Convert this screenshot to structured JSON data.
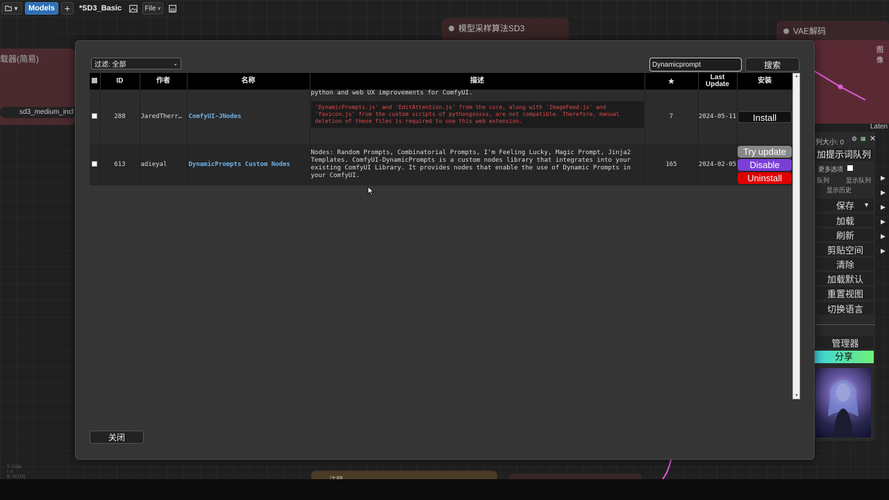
{
  "toolbar": {
    "models_label": "Models",
    "add_label": "+",
    "workflow_title": "*SD3_Basic",
    "file_label": "File"
  },
  "background_nodes": {
    "sampler_title": "模型采样算法SD3",
    "vae_title": "VAE解码",
    "left_title": "载器(简易)",
    "left_value": "sd3_medium_incl",
    "right_top_label": "图像",
    "right_latent_label": "Laten",
    "bottom_title": "注释",
    "bottom_stats": [
      "T: 0.00s",
      "I: 0",
      "N: 15 [15]"
    ]
  },
  "side_panel": {
    "queue_size": "列大小: 0",
    "enqueue": "加提示词队列",
    "more_options": "更多选项",
    "small_left": "队列",
    "small_right": "显示队列",
    "small_history": "显示历史",
    "items": [
      "保存",
      "加载",
      "刷新",
      "剪贴空间",
      "清除",
      "加载默认",
      "重置视图",
      "切换语言"
    ],
    "manager": "管理器",
    "share": "分享"
  },
  "modal": {
    "filter_label": "过滤: 全部",
    "search_value": "Dynamicprompt",
    "search_button": "搜索",
    "close_button": "关闭",
    "columns": {
      "id": "ID",
      "author": "作者",
      "name": "名称",
      "description": "描述",
      "stars": "★",
      "last_update": "Last Update",
      "install": "安装"
    },
    "rows": [
      {
        "id": "288",
        "author": "JaredTherr…",
        "name": "ComfyUI-JNodes",
        "description": "python and web UX improvements for ComfyUI.",
        "warning": "'DynamicPrompts.js' and 'EditAttention.js' from the core, along with 'ImageFeed.js' and 'favicon.js' from the custom scripts of pythongossss, are not compatible. Therefore, manual deletion of these files is required to use this web extension.",
        "stars": "7",
        "last_update": "2024-05-11",
        "install_label": "Install"
      },
      {
        "id": "613",
        "author": "adieyal",
        "name": "DynamicPrompts Custom Nodes",
        "description": "Nodes: Random Prompts, Combinatorial Prompts, I'm Feeling Lucky, Magic Prompt, Jinja2 Templates. ComfyUI-DynamicPrompts is a custom nodes library that integrates into your existing ComfyUI Library. It provides nodes that enable the use of Dynamic Prompts in your ComfyUI.",
        "stars": "165",
        "last_update": "2024-02-05",
        "try_update_label": "Try update",
        "disable_label": "Disable",
        "uninstall_label": "Uninstall"
      }
    ]
  },
  "colors": {
    "link": "#6fb4e9",
    "warning": "#e04b4b",
    "disable": "#7a3fd6",
    "uninstall": "#e00000",
    "share_start": "#3fd4e0",
    "share_end": "#6ef07a"
  }
}
